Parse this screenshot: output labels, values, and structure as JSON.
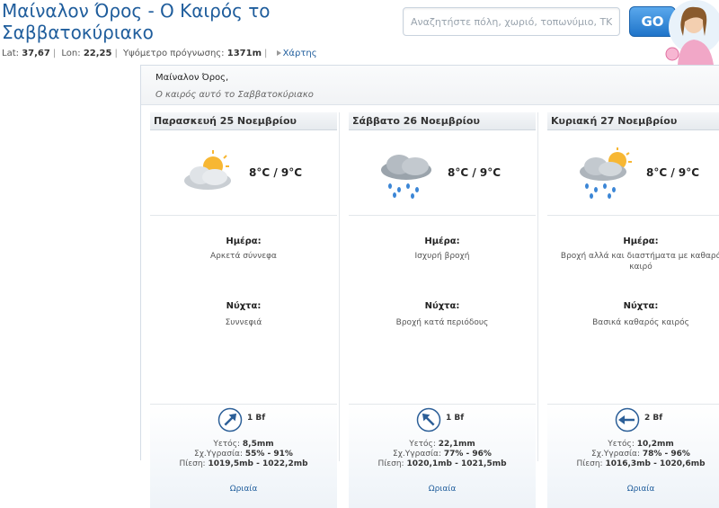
{
  "header": {
    "title": "Μαίναλον Όρος - Ο Καιρός το Σαββατοκύριακο",
    "search_placeholder": "Αναζητήστε πόλη, χωριό, τοπωνύμιο, ΤΚ...",
    "go_label": "GO"
  },
  "infobar": {
    "lat_label": "Lat:",
    "lat": "37,67",
    "lon_label": "Lon:",
    "lon": "22,25",
    "alt_label": "Υψόμετρο πρόγνωσης:",
    "alt": "1371m",
    "map_link": "Χάρτης"
  },
  "panel": {
    "place": "Μαίναλον Όρος,",
    "subtitle": "Ο καιρός αυτό το Σαββατοκύριακο"
  },
  "days": [
    {
      "date": "Παρασκευή 25 Νοεμβρίου",
      "icon": "partly-cloudy-sun-icon",
      "temp": "8°C / 9°C",
      "day_label": "Ημέρα:",
      "day_desc": "Αρκετά σύννεφα",
      "night_label": "Νύχτα:",
      "night_desc": "Συννεφιά",
      "wind": "1 Bf",
      "wind_dir_deg": 45,
      "rain_label": "Υετός:",
      "rain": "8,5mm",
      "hum_label": "Σχ.Υγρασία:",
      "hum": "55% - 91%",
      "press_label": "Πίεση:",
      "press": "1019,5mb - 1022,2mb",
      "hourly": "Ωριαία"
    },
    {
      "date": "Σάββατο 26 Νοεμβρίου",
      "icon": "heavy-rain-cloud-icon",
      "temp": "8°C / 9°C",
      "day_label": "Ημέρα:",
      "day_desc": "Ισχυρή βροχή",
      "night_label": "Νύχτα:",
      "night_desc": "Βροχή κατά περιόδους",
      "wind": "1 Bf",
      "wind_dir_deg": -45,
      "rain_label": "Υετός:",
      "rain": "22,1mm",
      "hum_label": "Σχ.Υγρασία:",
      "hum": "77% - 96%",
      "press_label": "Πίεση:",
      "press": "1020,1mb - 1021,5mb",
      "hourly": "Ωριαία"
    },
    {
      "date": "Κυριακή 27 Νοεμβρίου",
      "icon": "rain-sun-cloud-icon",
      "temp": "8°C / 9°C",
      "day_label": "Ημέρα:",
      "day_desc": "Βροχή αλλά και διαστήματα με καθαρό καιρό",
      "night_label": "Νύχτα:",
      "night_desc": "Βασικά καθαρός καιρός",
      "wind": "2 Bf",
      "wind_dir_deg": -90,
      "rain_label": "Υετός:",
      "rain": "10,2mm",
      "hum_label": "Σχ.Υγρασία:",
      "hum": "78% - 96%",
      "press_label": "Πίεση:",
      "press": "1016,3mb - 1020,6mb",
      "hourly": "Ωριαία"
    }
  ],
  "colors": {
    "accent": "#1f5d9c",
    "button": "#1f74c9"
  }
}
